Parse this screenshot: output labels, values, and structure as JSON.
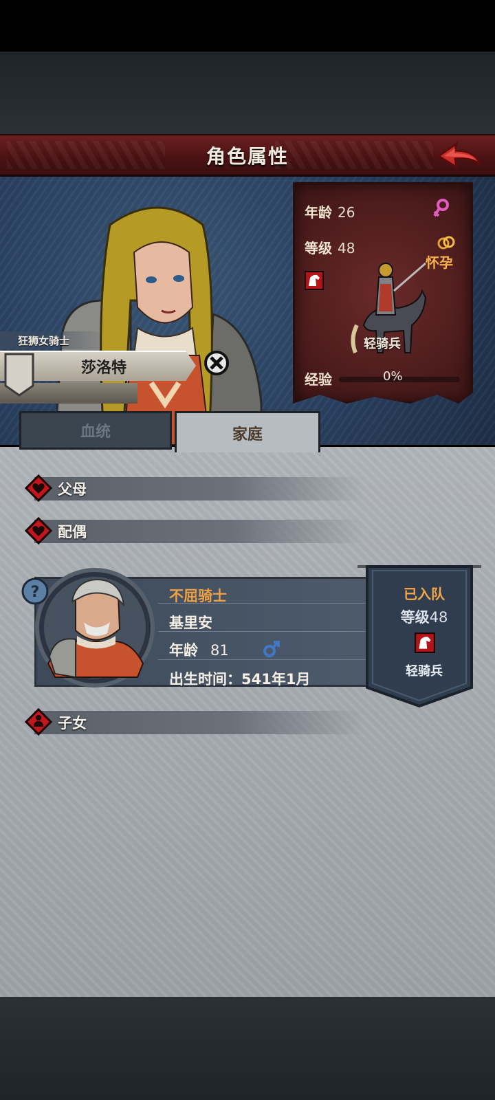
{
  "header": {
    "title": "角色属性"
  },
  "character": {
    "title": "狂狮女骑士",
    "name": "莎洛特",
    "stats": {
      "age_label": "年龄",
      "age": "26",
      "level_label": "等级",
      "level": "48",
      "exp_label": "经验",
      "exp": "0%",
      "exp_progress": 0.0,
      "status": "怀孕",
      "unit": "轻骑兵"
    }
  },
  "tabs": [
    {
      "label": "血统",
      "active": false
    },
    {
      "label": "家庭",
      "active": true
    }
  ],
  "family": {
    "parents_label": "父母",
    "spouse_label": "配偶",
    "children_label": "子女",
    "spouse": {
      "title": "不屈骑士",
      "name": "基里安",
      "age_label": "年龄",
      "age": "81",
      "birth": "出生时间：541年1月",
      "status": "已入队",
      "level_label": "等级",
      "level": "48",
      "unit": "轻骑兵"
    }
  },
  "colors": {
    "accent": "#f0a040",
    "header": "#5a1a1b",
    "female": "#e05cc0",
    "male": "#3f78c8"
  },
  "icons": [
    "back-arrow-icon",
    "dismiss-icon",
    "female-icon",
    "ring-icon",
    "cavalry-icon",
    "heart-icon",
    "child-icon",
    "help-icon",
    "male-icon"
  ]
}
